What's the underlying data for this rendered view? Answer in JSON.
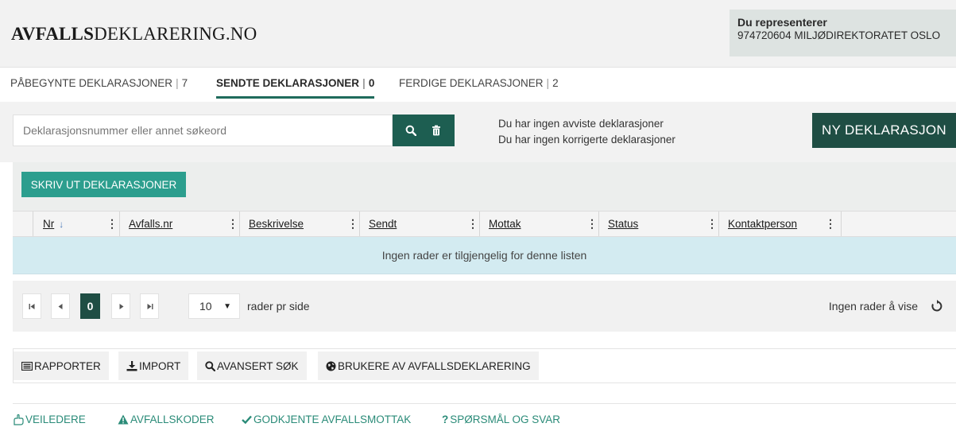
{
  "header": {
    "logo_bold": "AVFALLS",
    "logo_rest": "DEKLARERING.NO",
    "rep_title": "Du representerer",
    "rep_org": "974720604 MILJØDIREKTORATET OSLO"
  },
  "tabs": [
    {
      "label": "PÅBEGYNTE DEKLARASJONER",
      "count": "7"
    },
    {
      "label": "SENDTE DEKLARASJONER",
      "count": "0"
    },
    {
      "label": "FERDIGE DEKLARASJONER",
      "count": "2"
    }
  ],
  "tab_separator": "|",
  "search": {
    "placeholder": "Deklarasjonsnummer eller annet søkeord",
    "value": ""
  },
  "notices": {
    "line1": "Du har ingen avviste deklarasjoner",
    "line2": "Du har ingen korrigerte deklarasjoner"
  },
  "new_button": "NY DEKLARASJON",
  "grid": {
    "print_button": "SKRIV UT DEKLARASJONER",
    "columns": [
      "Nr",
      "Avfalls.nr",
      "Beskrivelse",
      "Sendt",
      "Mottak",
      "Status",
      "Kontaktperson"
    ],
    "sort_indicator": "↓",
    "col_menu": "⋮",
    "empty_message": "Ingen rader er tilgjengelig for denne listen"
  },
  "pager": {
    "current_page": "0",
    "page_size": "10",
    "page_size_label": "rader pr side",
    "info": "Ingen rader å vise"
  },
  "actions": [
    {
      "label": "RAPPORTER",
      "icon": "report-icon"
    },
    {
      "label": "IMPORT",
      "icon": "import-icon"
    },
    {
      "label": "AVANSERT SØK",
      "icon": "search-icon"
    },
    {
      "label": "BRUKERE AV AVFALLSDEKLARERING",
      "icon": "globe-icon"
    }
  ],
  "footer_links": [
    {
      "label": "VEILEDERE",
      "icon": "hand-icon"
    },
    {
      "label": "AVFALLSKODER",
      "icon": "warning-icon"
    },
    {
      "label": "GODKJENTE AVFALLSMOTTAK",
      "icon": "check-icon"
    },
    {
      "label": "SPØRSMÅL OG SVAR",
      "icon": "question-icon"
    }
  ],
  "colors": {
    "brand_dark": "#1f4e44",
    "teal": "#2c9e8e",
    "link": "#2a8b78",
    "empty_row": "#d3ebf1"
  }
}
